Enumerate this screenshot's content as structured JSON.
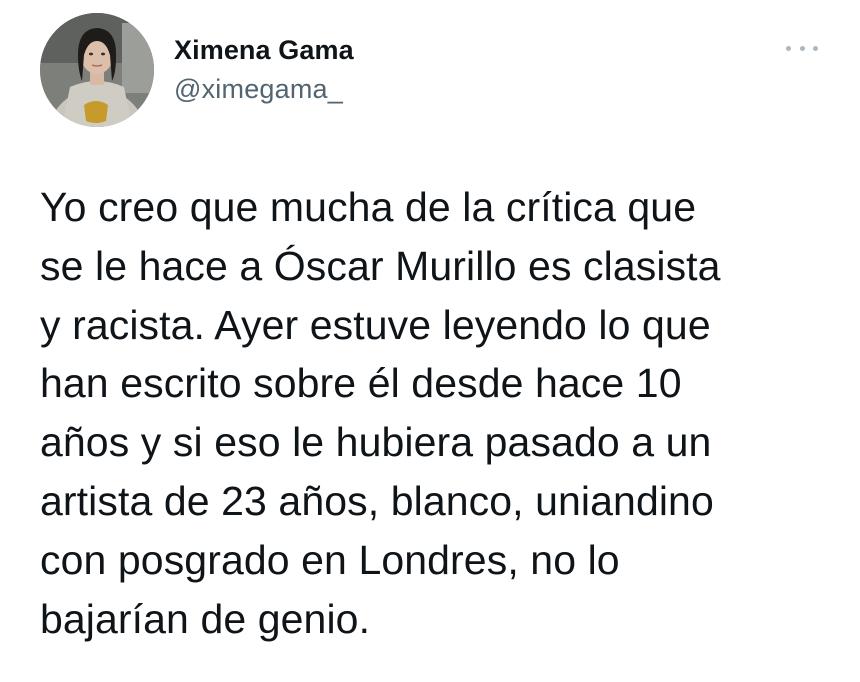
{
  "user": {
    "display_name": "Ximena Gama",
    "handle": "@ximegama_"
  },
  "more_icon": "more-horizontal-icon",
  "tweet": {
    "lines": [
      "Yo creo que mucha de la crítica que",
      "se le hace a Óscar Murillo es clasista",
      "y racista. Ayer estuve leyendo lo que",
      "han escrito sobre él desde hace 10",
      "años y si eso le hubiera pasado a un",
      "artista de 23 años, blanco, uniandino",
      "con posgrado en Londres, no lo",
      "bajarían de genio."
    ]
  },
  "colors": {
    "text": "#0f1419",
    "secondary": "#536471",
    "more_dots": "#aab8c2",
    "background": "#ffffff"
  }
}
